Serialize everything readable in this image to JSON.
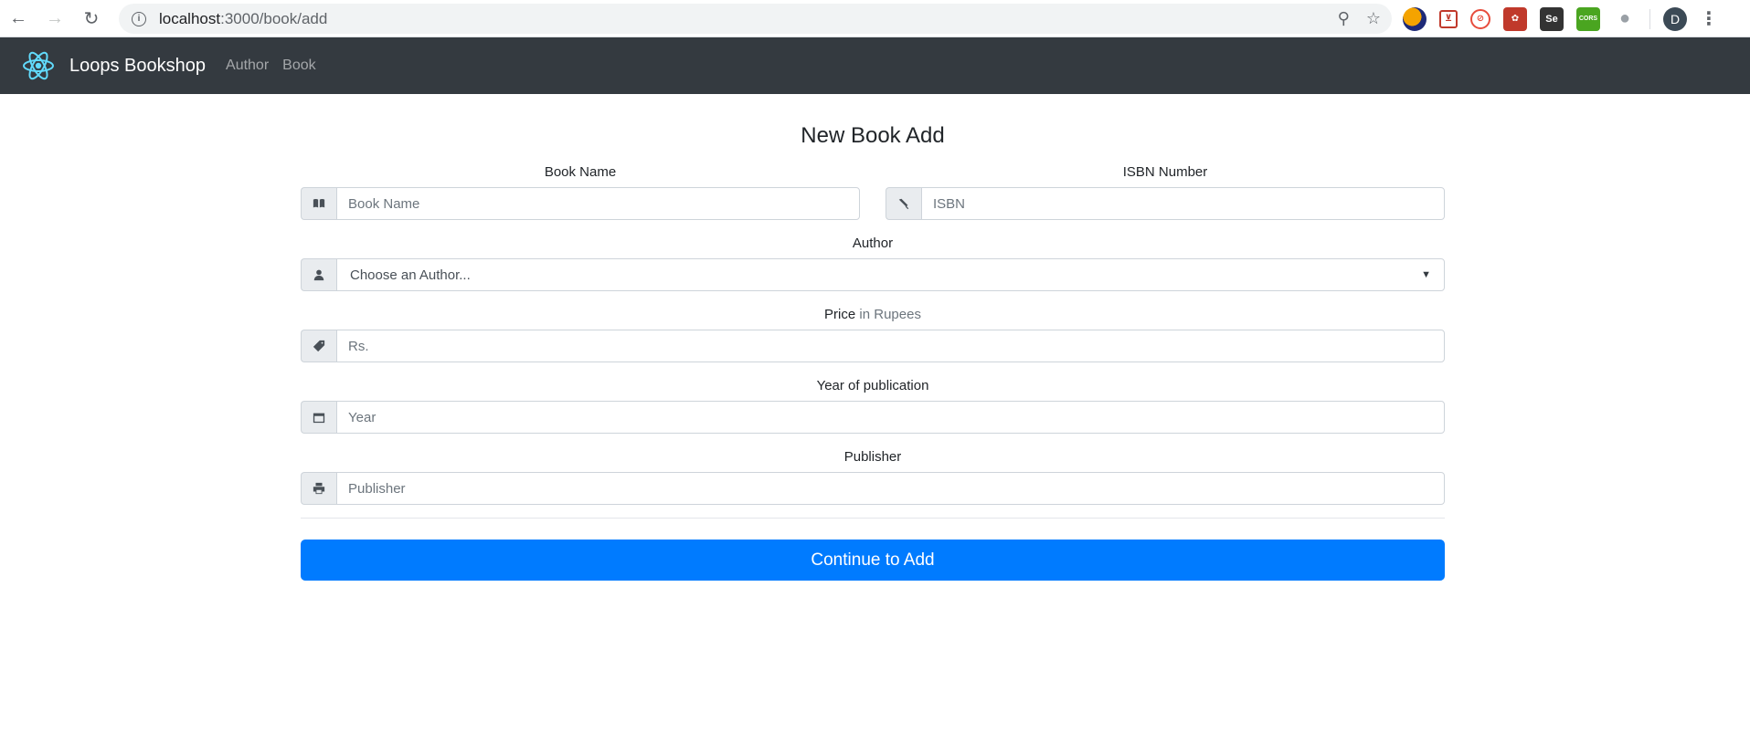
{
  "browser": {
    "url_host": "localhost",
    "url_path": ":3000/book/add",
    "profile_initial": "D",
    "extensions": [
      {
        "name": "ext-circle-icon",
        "glyph": ""
      },
      {
        "name": "ext-pocket-icon",
        "glyph": "⊻"
      },
      {
        "name": "ext-block-icon",
        "glyph": "⊘"
      },
      {
        "name": "ext-red-icon",
        "glyph": "✿"
      },
      {
        "name": "ext-selenium-icon",
        "glyph": "Se"
      },
      {
        "name": "ext-cors-icon",
        "glyph": "CORS"
      },
      {
        "name": "ext-camera-icon",
        "glyph": "📷"
      }
    ]
  },
  "navbar": {
    "brand": "Loops Bookshop",
    "links": [
      "Author",
      "Book"
    ],
    "logo_color": "#61dafb"
  },
  "form": {
    "title": "New Book Add",
    "book_name": {
      "label": "Book Name",
      "placeholder": "Book Name"
    },
    "isbn": {
      "label": "ISBN Number",
      "placeholder": "ISBN"
    },
    "author": {
      "label": "Author",
      "selected": "Choose an Author..."
    },
    "price": {
      "label": "Price",
      "label_suffix": "in Rupees",
      "placeholder": "Rs."
    },
    "year": {
      "label": "Year of publication",
      "placeholder": "Year"
    },
    "publisher": {
      "label": "Publisher",
      "placeholder": "Publisher"
    },
    "submit_label": "Continue to Add"
  },
  "colors": {
    "navbar_bg": "#343a40",
    "primary": "#007bff"
  }
}
